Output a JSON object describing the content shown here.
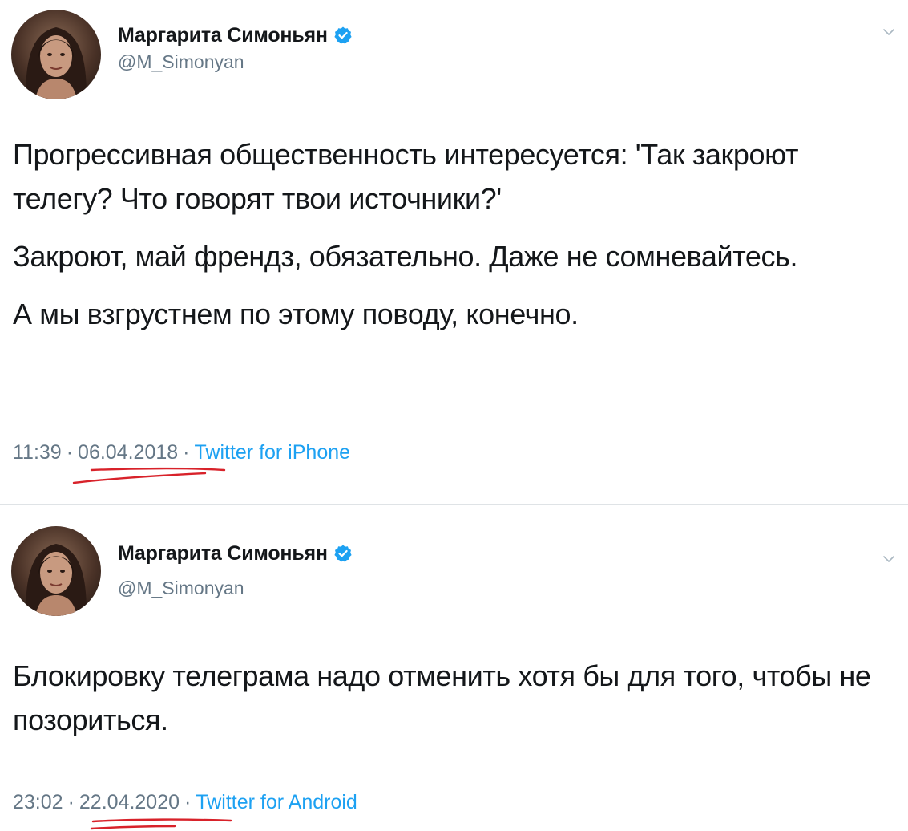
{
  "tweets": [
    {
      "author": {
        "display_name": "Маргарита Симоньян",
        "handle": "@M_Simonyan",
        "verified": true
      },
      "paragraphs": [
        "Прогрессивная общественность интересуется: 'Так закроют телегу? Что говорят твои источники?'",
        "Закроют, май френдз, обязательно. Даже не сомневайтесь.",
        "А мы взгрустнем по этому поводу, конечно."
      ],
      "time": "11:39",
      "date": "06.04.2018",
      "source": "Twitter for iPhone",
      "separator": "·"
    },
    {
      "author": {
        "display_name": "Маргарита Симоньян",
        "handle": "@M_Simonyan",
        "verified": true
      },
      "paragraphs": [
        "Блокировку телеграма надо отменить хотя бы для того, чтобы не позориться."
      ],
      "time": "23:02",
      "date": "22.04.2020",
      "source": "Twitter for Android",
      "separator": "·"
    }
  ],
  "icons": {
    "verified": "verified-badge-icon",
    "menu": "chevron-down-icon",
    "annotation": "red-underline-mark"
  },
  "colors": {
    "verified_blue": "#1da1f2",
    "meta_gray": "#657786",
    "text": "#14171a",
    "annotation_red": "#d8222a"
  }
}
